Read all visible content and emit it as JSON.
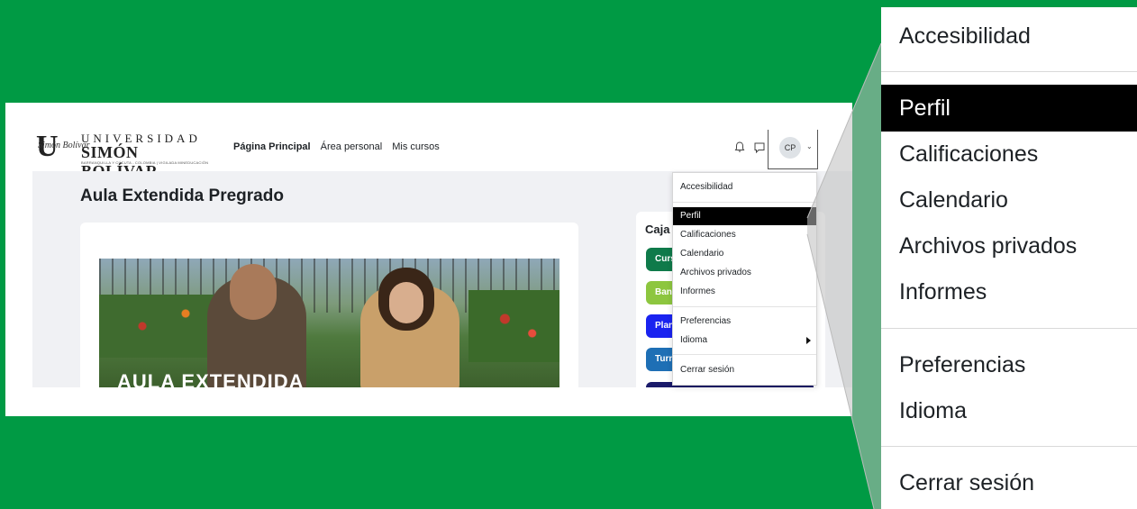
{
  "header": {
    "logo_line1": "UNIVERSIDAD",
    "logo_line2": "SIMÓN BOLÍVAR",
    "logo_line3": "BARRANQUILLA Y CÚCUTA - COLOMBIA  |  VIGILADA MINEDUCACIÓN",
    "nav": [
      "Página Principal",
      "Área personal",
      "Mis cursos"
    ],
    "user_initials": "CP"
  },
  "main": {
    "page_title": "Aula Extendida Pregrado",
    "hero_text": "AULA EXTENDIDA",
    "side_title": "Caja",
    "side_pills": [
      {
        "label": "Curs",
        "color": "#0f7a4a"
      },
      {
        "label": "Ban",
        "color": "#8dc63f"
      },
      {
        "label": "Plan",
        "color": "#1a23f0"
      },
      {
        "label": "Turn",
        "color": "#1e6fb5"
      }
    ]
  },
  "dropdown": {
    "items": [
      "Accesibilidad",
      "Perfil",
      "Calificaciones",
      "Calendario",
      "Archivos privados",
      "Informes",
      "Preferencias",
      "Idioma",
      "Cerrar sesión"
    ],
    "active": "Perfil"
  },
  "zoom_menu": {
    "items": [
      "Accesibilidad",
      "Perfil",
      "Calificaciones",
      "Calendario",
      "Archivos privados",
      "Informes",
      "Preferencias",
      "Idioma",
      "Cerrar sesión"
    ],
    "active": "Perfil"
  },
  "colors": {
    "background": "#009a44",
    "active_item": "#000000"
  }
}
